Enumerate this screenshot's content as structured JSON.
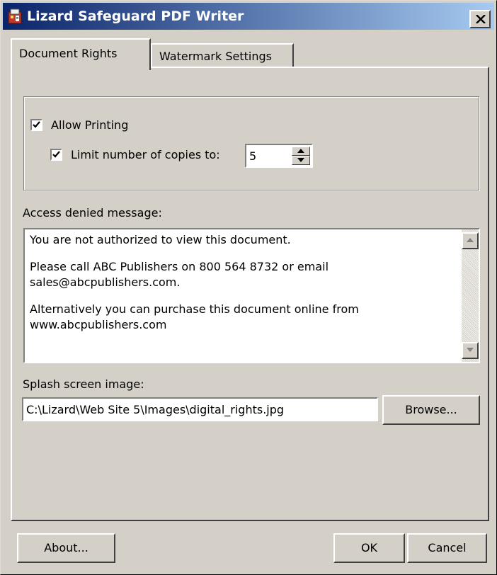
{
  "window": {
    "title": "Lizard Safeguard PDF Writer",
    "icon": "lizard-app-icon",
    "close_icon": "close-icon"
  },
  "tabs": [
    {
      "label": "Document Rights",
      "active": true
    },
    {
      "label": "Watermark Settings",
      "active": false
    }
  ],
  "printing": {
    "allow_printing_label": "Allow Printing",
    "allow_printing_checked": true,
    "limit_copies_label": "Limit number of copies to:",
    "limit_copies_checked": true,
    "copies_value": "5"
  },
  "access_denied": {
    "label": "Access denied message:",
    "lines": [
      "You are not authorized to view this document.",
      "Please call ABC Publishers on 800 564 8732 or email sales@abcpublishers.com.",
      "Alternatively you can purchase this document online from www.abcpublishers.com"
    ]
  },
  "splash": {
    "label": "Splash screen image:",
    "path": "C:\\Lizard\\Web Site 5\\Images\\digital_rights.jpg",
    "browse_label": "Browse..."
  },
  "footer": {
    "about_label": "About...",
    "ok_label": "OK",
    "cancel_label": "Cancel"
  },
  "colors": {
    "face": "#d4d0c8",
    "title_start": "#0a246a",
    "title_end": "#a6caf0"
  }
}
